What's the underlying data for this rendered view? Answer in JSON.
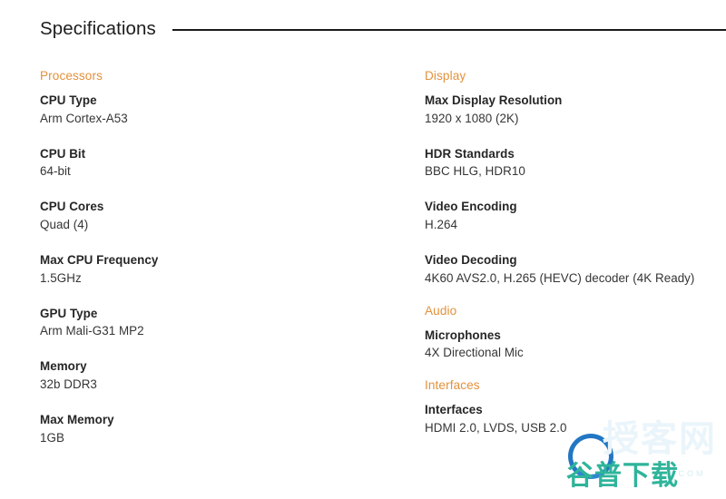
{
  "header": {
    "title": "Specifications"
  },
  "columns": {
    "left": [
      {
        "group": "Processors",
        "specs": [
          {
            "label": "CPU Type",
            "value": "Arm Cortex-A53"
          },
          {
            "label": "CPU Bit",
            "value": "64-bit"
          },
          {
            "label": "CPU Cores",
            "value": "Quad (4)"
          },
          {
            "label": "Max CPU Frequency",
            "value": "1.5GHz"
          },
          {
            "label": "GPU Type",
            "value": "Arm Mali-G31 MP2"
          },
          {
            "label": "Memory",
            "value": "32b DDR3"
          },
          {
            "label": "Max Memory",
            "value": "1GB"
          }
        ]
      }
    ],
    "right": [
      {
        "group": "Display",
        "specs": [
          {
            "label": "Max Display Resolution",
            "value": "1920 x 1080 (2K)"
          },
          {
            "label": "HDR Standards",
            "value": "BBC HLG, HDR10"
          },
          {
            "label": "Video Encoding",
            "value": "H.264"
          },
          {
            "label": "Video Decoding",
            "value": "4K60 AVS2.0, H.265 (HEVC) decoder (4K Ready)"
          }
        ]
      },
      {
        "group": "Audio",
        "specs": [
          {
            "label": "Microphones",
            "value": "4X Directional Mic"
          }
        ]
      },
      {
        "group": "Interfaces",
        "specs": [
          {
            "label": "Interfaces",
            "value": "HDMI 2.0, LVDS, USB 2.0"
          }
        ]
      }
    ]
  },
  "watermark": {
    "ghost_text": "授客网",
    "main_text": "谷普下载",
    "dotcom_text": ".COM",
    "ring_color": "#2277c4",
    "main_color": "#2fb49a"
  },
  "colors": {
    "group_heading": "#e3913c",
    "label": "#262626",
    "value": "#353535",
    "rule": "#1a1a1a",
    "background": "#ffffff"
  }
}
